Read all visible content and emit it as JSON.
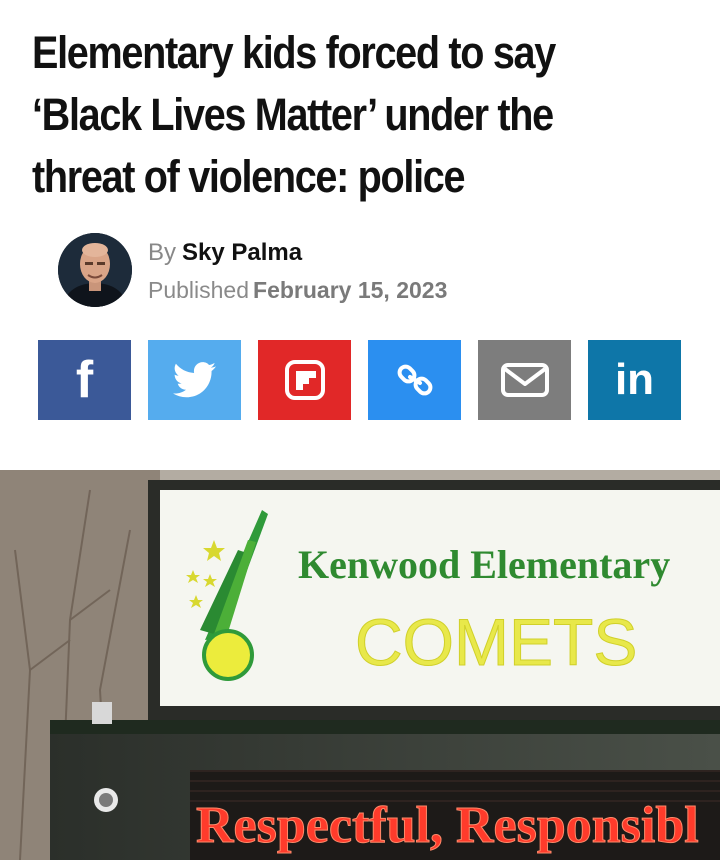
{
  "article": {
    "headline_line1": "Elementary kids forced to say",
    "headline_line2": "‘Black Lives Matter’ under the",
    "headline_line3": "threat of violence: police",
    "by_prefix": "By",
    "author": "Sky Palma",
    "published_prefix": "Published",
    "date": "February 15, 2023"
  },
  "share": {
    "buttons": [
      {
        "icon": "facebook-icon",
        "label": "f",
        "color": "#3b5998"
      },
      {
        "icon": "twitter-icon",
        "label": "",
        "color": "#55acee"
      },
      {
        "icon": "flipboard-icon",
        "label": "",
        "color": "#e12828"
      },
      {
        "icon": "link-icon",
        "label": "",
        "color": "#2b8ff0"
      },
      {
        "icon": "email-icon",
        "label": "",
        "color": "#7d7d7d"
      },
      {
        "icon": "linkedin-icon",
        "label": "in",
        "color": "#0e76a8"
      }
    ]
  },
  "photo": {
    "sign_line1": "Kenwood Elementary",
    "sign_line2": "COMETS",
    "led_text": "Respectful, Responsibl"
  }
}
